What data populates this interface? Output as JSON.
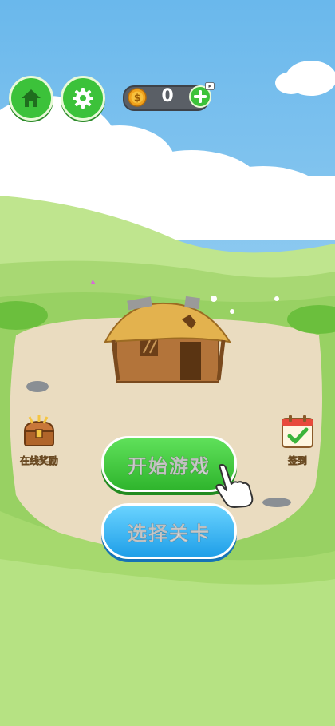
{
  "coins": {
    "value": "0"
  },
  "side": {
    "online_reward_label": "在线奖励",
    "checkin_label": "签到"
  },
  "buttons": {
    "start_label": "开始游戏",
    "select_level_label": "选择关卡"
  },
  "icons": {
    "home": "home-icon",
    "settings": "gear-icon",
    "coin": "coin-icon",
    "add": "plus-icon",
    "ad": "video-ad-icon",
    "chest": "treasure-chest-icon",
    "calendar": "calendar-check-icon",
    "hand": "pointing-hand-icon"
  },
  "colors": {
    "sky": "#7ec4ef",
    "grass": "#9cd86a",
    "dirt": "#eadcc0",
    "primary_green": "#3cc23a",
    "primary_blue": "#1f9fe8"
  }
}
